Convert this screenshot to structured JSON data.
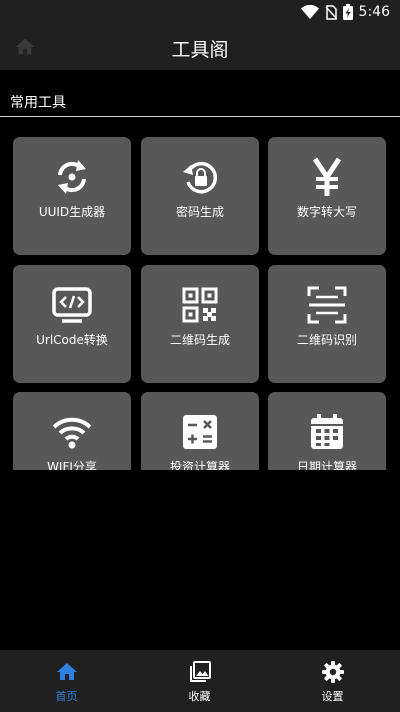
{
  "status_bar": {
    "time": "5:46",
    "icons": [
      "wifi-icon",
      "no-sim-icon",
      "battery-charging-icon"
    ]
  },
  "app_bar": {
    "title": "工具阁",
    "home_icon": "home-icon"
  },
  "section": {
    "title": "常用工具"
  },
  "tools": [
    {
      "label": "UUID生成器",
      "icon": "refresh-icon"
    },
    {
      "label": "密码生成",
      "icon": "lock-reset-icon"
    },
    {
      "label": "数字转大写",
      "icon": "yen-icon"
    },
    {
      "label": "UrlCode转换",
      "icon": "code-monitor-icon"
    },
    {
      "label": "二维码生成",
      "icon": "qr-code-icon"
    },
    {
      "label": "二维码识别",
      "icon": "scan-icon"
    },
    {
      "label": "WIFI分享",
      "icon": "wifi-icon"
    },
    {
      "label": "投资计算器",
      "icon": "calculator-icon"
    },
    {
      "label": "日期计算器",
      "icon": "calendar-icon"
    }
  ],
  "bottom_nav": [
    {
      "label": "首页",
      "icon": "home-icon",
      "active": true
    },
    {
      "label": "收藏",
      "icon": "gallery-icon",
      "active": false
    },
    {
      "label": "设置",
      "icon": "gear-icon",
      "active": false
    }
  ],
  "colors": {
    "background": "#000000",
    "bar": "#202020",
    "tile": "#585858",
    "accent": "#2f7fe0"
  }
}
